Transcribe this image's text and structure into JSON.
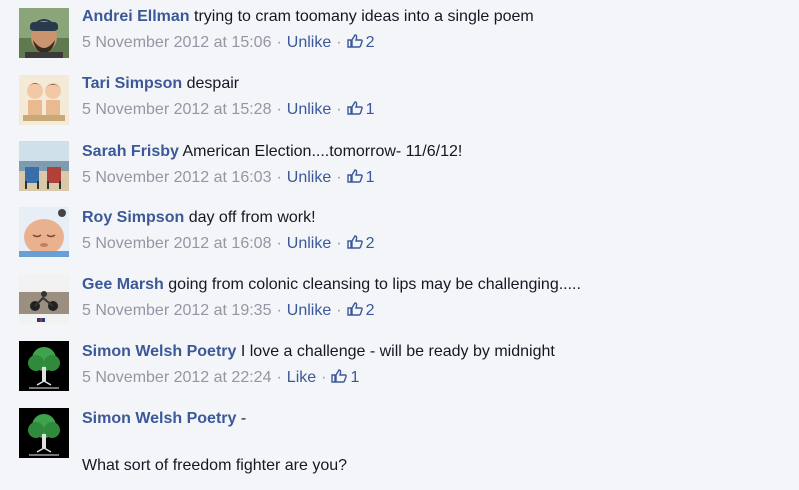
{
  "comments": [
    {
      "author": "Andrei Ellman",
      "text": "trying to cram toomany ideas into a single poem",
      "timestamp": "5 November 2012 at 15:06",
      "action": "Unlike",
      "like_count": "2",
      "avatar_icon": "man-beanie-avatar"
    },
    {
      "author": "Tari Simpson",
      "text": "despair",
      "timestamp": "5 November 2012 at 15:28",
      "action": "Unlike",
      "like_count": "1",
      "avatar_icon": "cartoon-couple-avatar"
    },
    {
      "author": "Sarah Frisby",
      "text": "American Election....tomorrow- 11/6/12!",
      "timestamp": "5 November 2012 at 16:03",
      "action": "Unlike",
      "like_count": "1",
      "avatar_icon": "beach-chairs-avatar"
    },
    {
      "author": "Roy Simpson",
      "text": "day off from work!",
      "timestamp": "5 November 2012 at 16:08",
      "action": "Unlike",
      "like_count": "2",
      "avatar_icon": "sleeping-baby-avatar"
    },
    {
      "author": "Gee Marsh",
      "text": "going from colonic cleansing to lips may be challenging.....",
      "timestamp": "5 November 2012 at 19:35",
      "action": "Unlike",
      "like_count": "2",
      "avatar_icon": "motorbike-avatar"
    },
    {
      "author": "Simon Welsh Poetry",
      "text": "I love a challenge - will be ready by midnight",
      "timestamp": "5 November 2012 at 22:24",
      "action": "Like",
      "like_count": "1",
      "avatar_icon": "tree-logo-avatar"
    },
    {
      "author": "Simon Welsh Poetry",
      "text": "-",
      "avatar_icon": "tree-logo-avatar"
    }
  ],
  "last_comment_body": "What sort of freedom fighter are you?",
  "colors": {
    "background": "#f4f5f8",
    "author_link": "#3b5998",
    "meta_text": "#9197a3",
    "body_text": "#141823"
  }
}
